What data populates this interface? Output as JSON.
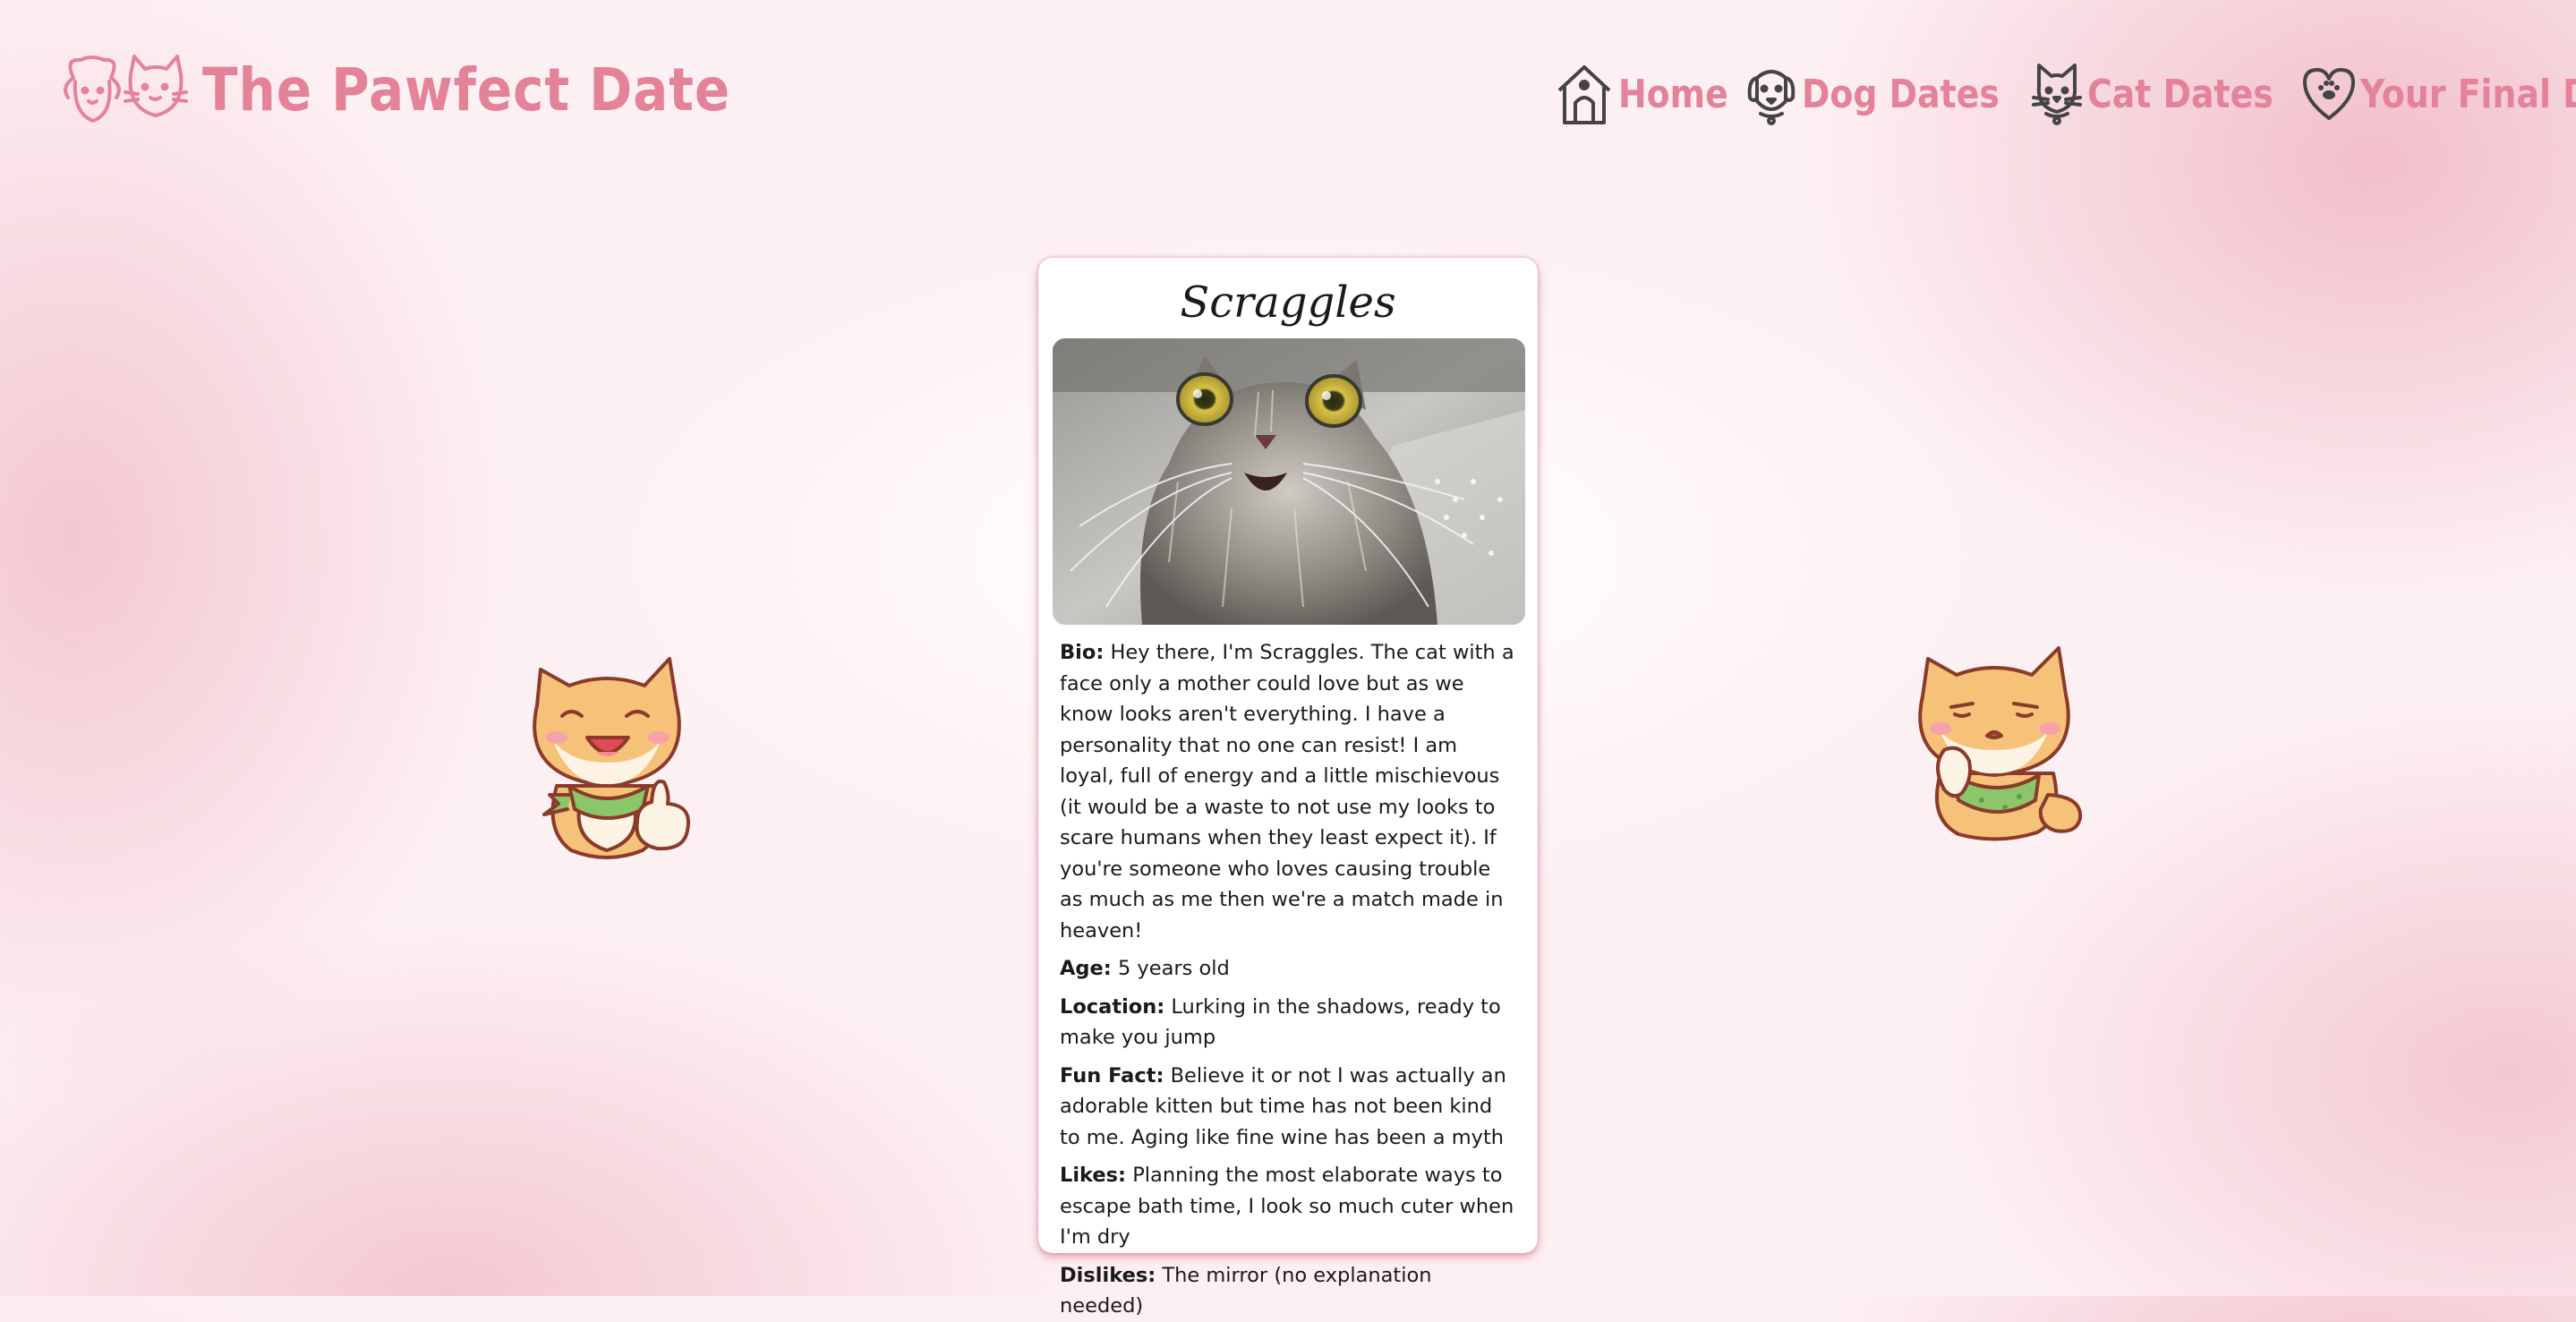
{
  "header": {
    "brand_name": "The Pawfect Date",
    "logo_icon": "dog-and-cat-logo"
  },
  "nav": {
    "items": [
      {
        "label": "Home",
        "icon": "doghouse-icon"
      },
      {
        "label": "Dog Dates",
        "icon": "dog-icon"
      },
      {
        "label": "Cat Dates",
        "icon": "cat-icon"
      },
      {
        "label": "Your Final Dates",
        "icon": "heart-paw-icon"
      }
    ]
  },
  "profile": {
    "name": "Scraggles",
    "photo_icon": "cat-photo",
    "bio_label": "Bio:",
    "bio": "Hey there, I'm Scraggles. The cat with a face only a mother could love but as we know looks aren't everything. I have a personality that no one can resist! I am loyal, full of energy and a little mischievous (it would be a waste to not use my looks to scare humans when they least expect it). If you're someone who loves causing trouble as much as me then we're a match made in heaven!",
    "age_label": "Age:",
    "age": "5 years old",
    "location_label": "Location:",
    "location": "Lurking in the shadows, ready to make you jump",
    "fun_fact_label": "Fun Fact:",
    "fun_fact": "Believe it or not I was actually an adorable kitten but time has not been kind to me. Aging like fine wine has been a myth",
    "likes_label": "Likes:",
    "likes": "Planning the most elaborate ways to escape bath time, I look so much cuter when I'm dry",
    "dislikes_label": "Dislikes:",
    "dislikes": "The mirror (no explanation needed)"
  },
  "colors": {
    "brand_pink": "#e48297",
    "card_shadow": "#d25a73",
    "text": "#1a1a1a"
  },
  "decorations": [
    "shiba-thumbs-up-sticker",
    "shiba-thinking-sticker"
  ]
}
